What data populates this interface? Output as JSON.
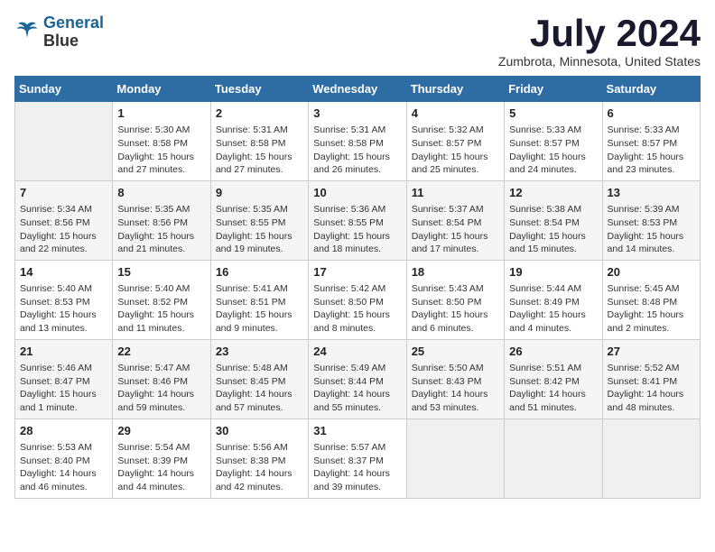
{
  "header": {
    "logo_line1": "General",
    "logo_line2": "Blue",
    "month": "July 2024",
    "location": "Zumbrota, Minnesota, United States"
  },
  "days_of_week": [
    "Sunday",
    "Monday",
    "Tuesday",
    "Wednesday",
    "Thursday",
    "Friday",
    "Saturday"
  ],
  "weeks": [
    [
      {
        "num": "",
        "empty": true
      },
      {
        "num": "1",
        "rise": "Sunrise: 5:30 AM",
        "set": "Sunset: 8:58 PM",
        "daylight": "Daylight: 15 hours and 27 minutes."
      },
      {
        "num": "2",
        "rise": "Sunrise: 5:31 AM",
        "set": "Sunset: 8:58 PM",
        "daylight": "Daylight: 15 hours and 27 minutes."
      },
      {
        "num": "3",
        "rise": "Sunrise: 5:31 AM",
        "set": "Sunset: 8:58 PM",
        "daylight": "Daylight: 15 hours and 26 minutes."
      },
      {
        "num": "4",
        "rise": "Sunrise: 5:32 AM",
        "set": "Sunset: 8:57 PM",
        "daylight": "Daylight: 15 hours and 25 minutes."
      },
      {
        "num": "5",
        "rise": "Sunrise: 5:33 AM",
        "set": "Sunset: 8:57 PM",
        "daylight": "Daylight: 15 hours and 24 minutes."
      },
      {
        "num": "6",
        "rise": "Sunrise: 5:33 AM",
        "set": "Sunset: 8:57 PM",
        "daylight": "Daylight: 15 hours and 23 minutes."
      }
    ],
    [
      {
        "num": "7",
        "rise": "Sunrise: 5:34 AM",
        "set": "Sunset: 8:56 PM",
        "daylight": "Daylight: 15 hours and 22 minutes."
      },
      {
        "num": "8",
        "rise": "Sunrise: 5:35 AM",
        "set": "Sunset: 8:56 PM",
        "daylight": "Daylight: 15 hours and 21 minutes."
      },
      {
        "num": "9",
        "rise": "Sunrise: 5:35 AM",
        "set": "Sunset: 8:55 PM",
        "daylight": "Daylight: 15 hours and 19 minutes."
      },
      {
        "num": "10",
        "rise": "Sunrise: 5:36 AM",
        "set": "Sunset: 8:55 PM",
        "daylight": "Daylight: 15 hours and 18 minutes."
      },
      {
        "num": "11",
        "rise": "Sunrise: 5:37 AM",
        "set": "Sunset: 8:54 PM",
        "daylight": "Daylight: 15 hours and 17 minutes."
      },
      {
        "num": "12",
        "rise": "Sunrise: 5:38 AM",
        "set": "Sunset: 8:54 PM",
        "daylight": "Daylight: 15 hours and 15 minutes."
      },
      {
        "num": "13",
        "rise": "Sunrise: 5:39 AM",
        "set": "Sunset: 8:53 PM",
        "daylight": "Daylight: 15 hours and 14 minutes."
      }
    ],
    [
      {
        "num": "14",
        "rise": "Sunrise: 5:40 AM",
        "set": "Sunset: 8:53 PM",
        "daylight": "Daylight: 15 hours and 13 minutes."
      },
      {
        "num": "15",
        "rise": "Sunrise: 5:40 AM",
        "set": "Sunset: 8:52 PM",
        "daylight": "Daylight: 15 hours and 11 minutes."
      },
      {
        "num": "16",
        "rise": "Sunrise: 5:41 AM",
        "set": "Sunset: 8:51 PM",
        "daylight": "Daylight: 15 hours and 9 minutes."
      },
      {
        "num": "17",
        "rise": "Sunrise: 5:42 AM",
        "set": "Sunset: 8:50 PM",
        "daylight": "Daylight: 15 hours and 8 minutes."
      },
      {
        "num": "18",
        "rise": "Sunrise: 5:43 AM",
        "set": "Sunset: 8:50 PM",
        "daylight": "Daylight: 15 hours and 6 minutes."
      },
      {
        "num": "19",
        "rise": "Sunrise: 5:44 AM",
        "set": "Sunset: 8:49 PM",
        "daylight": "Daylight: 15 hours and 4 minutes."
      },
      {
        "num": "20",
        "rise": "Sunrise: 5:45 AM",
        "set": "Sunset: 8:48 PM",
        "daylight": "Daylight: 15 hours and 2 minutes."
      }
    ],
    [
      {
        "num": "21",
        "rise": "Sunrise: 5:46 AM",
        "set": "Sunset: 8:47 PM",
        "daylight": "Daylight: 15 hours and 1 minute."
      },
      {
        "num": "22",
        "rise": "Sunrise: 5:47 AM",
        "set": "Sunset: 8:46 PM",
        "daylight": "Daylight: 14 hours and 59 minutes."
      },
      {
        "num": "23",
        "rise": "Sunrise: 5:48 AM",
        "set": "Sunset: 8:45 PM",
        "daylight": "Daylight: 14 hours and 57 minutes."
      },
      {
        "num": "24",
        "rise": "Sunrise: 5:49 AM",
        "set": "Sunset: 8:44 PM",
        "daylight": "Daylight: 14 hours and 55 minutes."
      },
      {
        "num": "25",
        "rise": "Sunrise: 5:50 AM",
        "set": "Sunset: 8:43 PM",
        "daylight": "Daylight: 14 hours and 53 minutes."
      },
      {
        "num": "26",
        "rise": "Sunrise: 5:51 AM",
        "set": "Sunset: 8:42 PM",
        "daylight": "Daylight: 14 hours and 51 minutes."
      },
      {
        "num": "27",
        "rise": "Sunrise: 5:52 AM",
        "set": "Sunset: 8:41 PM",
        "daylight": "Daylight: 14 hours and 48 minutes."
      }
    ],
    [
      {
        "num": "28",
        "rise": "Sunrise: 5:53 AM",
        "set": "Sunset: 8:40 PM",
        "daylight": "Daylight: 14 hours and 46 minutes."
      },
      {
        "num": "29",
        "rise": "Sunrise: 5:54 AM",
        "set": "Sunset: 8:39 PM",
        "daylight": "Daylight: 14 hours and 44 minutes."
      },
      {
        "num": "30",
        "rise": "Sunrise: 5:56 AM",
        "set": "Sunset: 8:38 PM",
        "daylight": "Daylight: 14 hours and 42 minutes."
      },
      {
        "num": "31",
        "rise": "Sunrise: 5:57 AM",
        "set": "Sunset: 8:37 PM",
        "daylight": "Daylight: 14 hours and 39 minutes."
      },
      {
        "num": "",
        "empty": true
      },
      {
        "num": "",
        "empty": true
      },
      {
        "num": "",
        "empty": true
      }
    ]
  ]
}
